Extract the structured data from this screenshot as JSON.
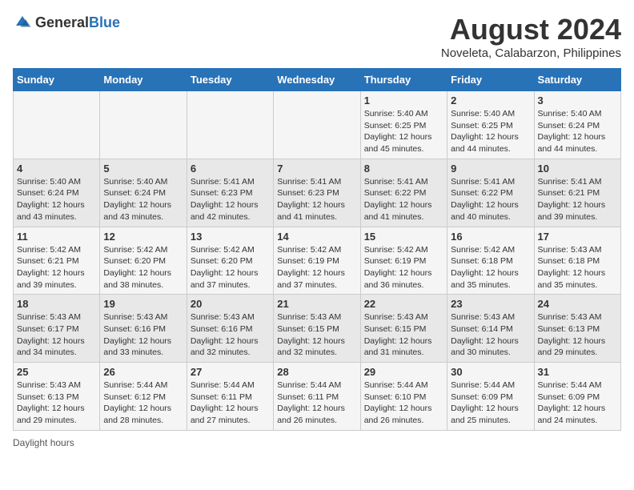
{
  "logo": {
    "general": "General",
    "blue": "Blue"
  },
  "title": "August 2024",
  "subtitle": "Noveleta, Calabarzon, Philippines",
  "days_of_week": [
    "Sunday",
    "Monday",
    "Tuesday",
    "Wednesday",
    "Thursday",
    "Friday",
    "Saturday"
  ],
  "weeks": [
    [
      {
        "day": "",
        "detail": ""
      },
      {
        "day": "",
        "detail": ""
      },
      {
        "day": "",
        "detail": ""
      },
      {
        "day": "",
        "detail": ""
      },
      {
        "day": "1",
        "detail": "Sunrise: 5:40 AM\nSunset: 6:25 PM\nDaylight: 12 hours\nand 45 minutes."
      },
      {
        "day": "2",
        "detail": "Sunrise: 5:40 AM\nSunset: 6:25 PM\nDaylight: 12 hours\nand 44 minutes."
      },
      {
        "day": "3",
        "detail": "Sunrise: 5:40 AM\nSunset: 6:24 PM\nDaylight: 12 hours\nand 44 minutes."
      }
    ],
    [
      {
        "day": "4",
        "detail": "Sunrise: 5:40 AM\nSunset: 6:24 PM\nDaylight: 12 hours\nand 43 minutes."
      },
      {
        "day": "5",
        "detail": "Sunrise: 5:40 AM\nSunset: 6:24 PM\nDaylight: 12 hours\nand 43 minutes."
      },
      {
        "day": "6",
        "detail": "Sunrise: 5:41 AM\nSunset: 6:23 PM\nDaylight: 12 hours\nand 42 minutes."
      },
      {
        "day": "7",
        "detail": "Sunrise: 5:41 AM\nSunset: 6:23 PM\nDaylight: 12 hours\nand 41 minutes."
      },
      {
        "day": "8",
        "detail": "Sunrise: 5:41 AM\nSunset: 6:22 PM\nDaylight: 12 hours\nand 41 minutes."
      },
      {
        "day": "9",
        "detail": "Sunrise: 5:41 AM\nSunset: 6:22 PM\nDaylight: 12 hours\nand 40 minutes."
      },
      {
        "day": "10",
        "detail": "Sunrise: 5:41 AM\nSunset: 6:21 PM\nDaylight: 12 hours\nand 39 minutes."
      }
    ],
    [
      {
        "day": "11",
        "detail": "Sunrise: 5:42 AM\nSunset: 6:21 PM\nDaylight: 12 hours\nand 39 minutes."
      },
      {
        "day": "12",
        "detail": "Sunrise: 5:42 AM\nSunset: 6:20 PM\nDaylight: 12 hours\nand 38 minutes."
      },
      {
        "day": "13",
        "detail": "Sunrise: 5:42 AM\nSunset: 6:20 PM\nDaylight: 12 hours\nand 37 minutes."
      },
      {
        "day": "14",
        "detail": "Sunrise: 5:42 AM\nSunset: 6:19 PM\nDaylight: 12 hours\nand 37 minutes."
      },
      {
        "day": "15",
        "detail": "Sunrise: 5:42 AM\nSunset: 6:19 PM\nDaylight: 12 hours\nand 36 minutes."
      },
      {
        "day": "16",
        "detail": "Sunrise: 5:42 AM\nSunset: 6:18 PM\nDaylight: 12 hours\nand 35 minutes."
      },
      {
        "day": "17",
        "detail": "Sunrise: 5:43 AM\nSunset: 6:18 PM\nDaylight: 12 hours\nand 35 minutes."
      }
    ],
    [
      {
        "day": "18",
        "detail": "Sunrise: 5:43 AM\nSunset: 6:17 PM\nDaylight: 12 hours\nand 34 minutes."
      },
      {
        "day": "19",
        "detail": "Sunrise: 5:43 AM\nSunset: 6:16 PM\nDaylight: 12 hours\nand 33 minutes."
      },
      {
        "day": "20",
        "detail": "Sunrise: 5:43 AM\nSunset: 6:16 PM\nDaylight: 12 hours\nand 32 minutes."
      },
      {
        "day": "21",
        "detail": "Sunrise: 5:43 AM\nSunset: 6:15 PM\nDaylight: 12 hours\nand 32 minutes."
      },
      {
        "day": "22",
        "detail": "Sunrise: 5:43 AM\nSunset: 6:15 PM\nDaylight: 12 hours\nand 31 minutes."
      },
      {
        "day": "23",
        "detail": "Sunrise: 5:43 AM\nSunset: 6:14 PM\nDaylight: 12 hours\nand 30 minutes."
      },
      {
        "day": "24",
        "detail": "Sunrise: 5:43 AM\nSunset: 6:13 PM\nDaylight: 12 hours\nand 29 minutes."
      }
    ],
    [
      {
        "day": "25",
        "detail": "Sunrise: 5:43 AM\nSunset: 6:13 PM\nDaylight: 12 hours\nand 29 minutes."
      },
      {
        "day": "26",
        "detail": "Sunrise: 5:44 AM\nSunset: 6:12 PM\nDaylight: 12 hours\nand 28 minutes."
      },
      {
        "day": "27",
        "detail": "Sunrise: 5:44 AM\nSunset: 6:11 PM\nDaylight: 12 hours\nand 27 minutes."
      },
      {
        "day": "28",
        "detail": "Sunrise: 5:44 AM\nSunset: 6:11 PM\nDaylight: 12 hours\nand 26 minutes."
      },
      {
        "day": "29",
        "detail": "Sunrise: 5:44 AM\nSunset: 6:10 PM\nDaylight: 12 hours\nand 26 minutes."
      },
      {
        "day": "30",
        "detail": "Sunrise: 5:44 AM\nSunset: 6:09 PM\nDaylight: 12 hours\nand 25 minutes."
      },
      {
        "day": "31",
        "detail": "Sunrise: 5:44 AM\nSunset: 6:09 PM\nDaylight: 12 hours\nand 24 minutes."
      }
    ]
  ],
  "footer": "Daylight hours"
}
